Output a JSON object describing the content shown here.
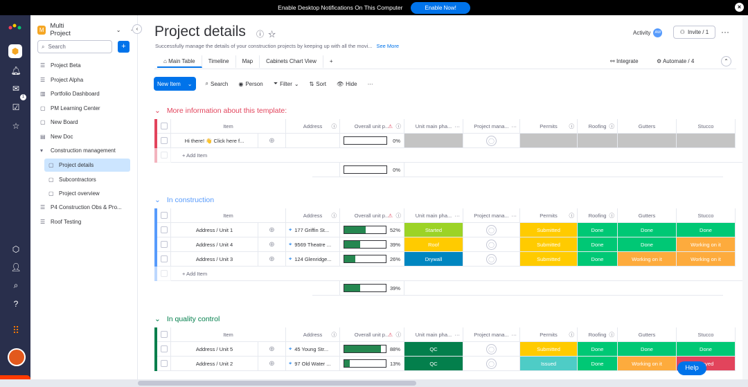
{
  "notification": {
    "text": "Enable Desktop Notifications On This Computer",
    "button": "Enable Now!"
  },
  "workspace": {
    "badge": "M",
    "name": "Multi Project"
  },
  "sidebar": {
    "search_placeholder": "Search",
    "items": [
      {
        "label": "Project Beta",
        "icon": "board-icon"
      },
      {
        "label": "Project Alpha",
        "icon": "board-icon"
      },
      {
        "label": "Portfolio Dashboard",
        "icon": "dashboard-icon"
      },
      {
        "label": "PM Learning Center",
        "icon": "board-icon"
      },
      {
        "label": "New Board",
        "icon": "board-icon"
      },
      {
        "label": "New Doc",
        "icon": "doc-icon"
      },
      {
        "label": "Construction management",
        "icon": "folder-icon"
      },
      {
        "label": "Project details",
        "icon": "board-icon"
      },
      {
        "label": "Subcontractors",
        "icon": "board-icon"
      },
      {
        "label": "Project overview",
        "icon": "board-icon"
      },
      {
        "label": "P4 Construction Obs & Pro...",
        "icon": "board-icon"
      },
      {
        "label": "Roof Testing",
        "icon": "board-icon"
      }
    ]
  },
  "header": {
    "title": "Project details",
    "description": "Successfully manage the details of your construction projects by keeping up with all the movi...",
    "see_more": "See More",
    "activity": "Activity",
    "avatar_initials": "AW",
    "invite": "Invite / 1"
  },
  "tabs": [
    "Main Table",
    "Timeline",
    "Map",
    "Cabinets Chart View",
    "+"
  ],
  "tab_actions": {
    "integrate": "Integrate",
    "automate": "Automate / 4"
  },
  "toolbar": {
    "new_item": "New Item",
    "search": "Search",
    "person": "Person",
    "filter": "Filter",
    "sort": "Sort",
    "hide": "Hide"
  },
  "columns": [
    "Item",
    "Address",
    "Overall unit p...",
    "Unit main pha...",
    "Project mana...",
    "Permits",
    "Roofing",
    "Gutters",
    "Stucco"
  ],
  "add_item": "+ Add Item",
  "colors": {
    "green": "#00c875",
    "orange": "#fdab3d",
    "yellow": "#ffcb00",
    "lime": "#9cd326",
    "blue": "#0086c0",
    "darkgreen": "#037f4c",
    "teal": "#4eccc6",
    "grey": "#c4c4c4"
  },
  "groups": [
    {
      "title": "More information about this template:",
      "color": "#e2445c",
      "rows": [
        {
          "item": "Hi there! 👋 Click here f...",
          "address": "",
          "progress": 0,
          "progress_label": "0%",
          "phase": "",
          "phase_color": "#c4c4c4",
          "permits": "",
          "permits_color": "#c4c4c4",
          "roofing": "",
          "roofing_color": "#c4c4c4",
          "gutters": "",
          "gutters_color": "#c4c4c4",
          "stucco": "",
          "stucco_color": "#c4c4c4"
        }
      ],
      "summary": {
        "progress": 0,
        "label": "0%"
      }
    },
    {
      "title": "In construction",
      "color": "#579bfc",
      "rows": [
        {
          "item": "Address / Unit 1",
          "address": "177 Griffin St...",
          "progress": 52,
          "progress_label": "52%",
          "phase": "Started",
          "phase_color": "#9cd326",
          "permits": "Submitted",
          "permits_color": "#ffcb00",
          "roofing": "Done",
          "roofing_color": "#00c875",
          "gutters": "Done",
          "gutters_color": "#00c875",
          "stucco": "Done",
          "stucco_color": "#00c875"
        },
        {
          "item": "Address / Unit 4",
          "address": "9569 Theatre ...",
          "progress": 39,
          "progress_label": "39%",
          "phase": "Roof",
          "phase_color": "#ffcb00",
          "permits": "Submitted",
          "permits_color": "#ffcb00",
          "roofing": "Done",
          "roofing_color": "#00c875",
          "gutters": "Done",
          "gutters_color": "#00c875",
          "stucco": "Working on it",
          "stucco_color": "#fdab3d"
        },
        {
          "item": "Address / Unit 3",
          "address": "124 Glenridge...",
          "progress": 26,
          "progress_label": "26%",
          "phase": "Drywall",
          "phase_color": "#0086c0",
          "permits": "Submitted",
          "permits_color": "#ffcb00",
          "roofing": "Done",
          "roofing_color": "#00c875",
          "gutters": "Working on it",
          "gutters_color": "#fdab3d",
          "stucco": "Working on it",
          "stucco_color": "#fdab3d"
        }
      ],
      "summary": {
        "progress": 39,
        "label": "39%"
      }
    },
    {
      "title": "In quality control",
      "color": "#037f4c",
      "rows": [
        {
          "item": "Address / Unit 5",
          "address": "45 Young Str...",
          "progress": 88,
          "progress_label": "88%",
          "phase": "QC",
          "phase_color": "#037f4c",
          "permits": "Submitted",
          "permits_color": "#ffcb00",
          "roofing": "Done",
          "roofing_color": "#00c875",
          "gutters": "Done",
          "gutters_color": "#00c875",
          "stucco": "Done",
          "stucco_color": "#00c875"
        },
        {
          "item": "Address / Unit 2",
          "address": "97 Old Water ...",
          "progress": 13,
          "progress_label": "13%",
          "phase": "QC",
          "phase_color": "#037f4c",
          "permits": "Issued",
          "permits_color": "#4eccc6",
          "roofing": "Done",
          "roofing_color": "#00c875",
          "gutters": "Working on it",
          "gutters_color": "#fdab3d",
          "stucco": "...ayed",
          "stucco_color": "#e2445c"
        }
      ]
    }
  ],
  "help": "Help"
}
